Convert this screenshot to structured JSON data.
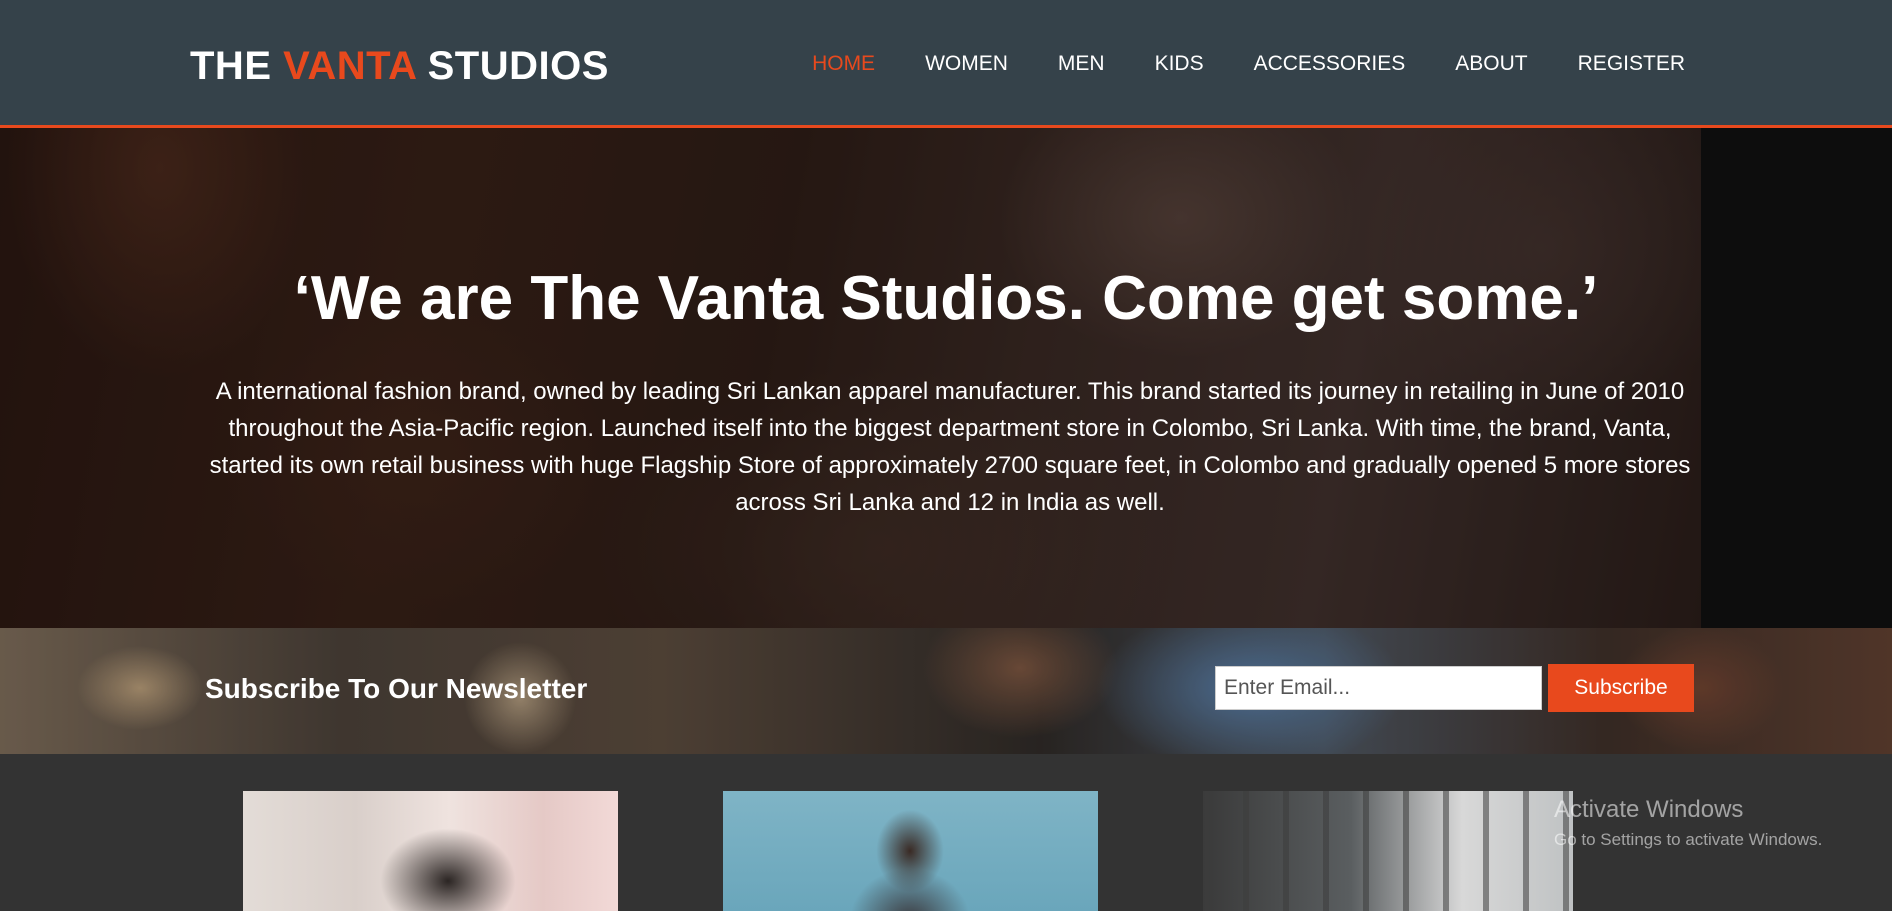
{
  "header": {
    "logo": {
      "part1": "THE ",
      "highlight": "VANTA",
      "part2": " STUDIOS"
    },
    "nav": [
      {
        "label": "HOME",
        "active": true
      },
      {
        "label": "WOMEN"
      },
      {
        "label": "MEN"
      },
      {
        "label": "KIDS"
      },
      {
        "label": "ACCESSORIES"
      },
      {
        "label": "ABOUT"
      },
      {
        "label": "REGISTER"
      }
    ]
  },
  "hero": {
    "title": "‘We are The Vanta Studios. Come get some.’",
    "text": "A international fashion brand, owned by leading Sri Lankan apparel manufacturer. This brand started its journey in retailing in June of 2010 throughout the Asia-Pacific region. Launched itself into the biggest department store in Colombo, Sri Lanka. With time, the brand, Vanta, started its own retail business with huge Flagship Store of approximately 2700 square feet, in Colombo and gradually opened 5 more stores across Sri Lanka and 12 in India as well."
  },
  "newsletter": {
    "heading": "Subscribe To Our Newsletter",
    "email_placeholder": "Enter Email...",
    "email_value": "",
    "subscribe_label": "Subscribe"
  },
  "watermark": {
    "title": "Activate Windows",
    "subtitle": "Go to Settings to activate Windows."
  },
  "colors": {
    "header_bg": "#35424a",
    "accent": "#e8491d",
    "page_bg": "#333333"
  }
}
